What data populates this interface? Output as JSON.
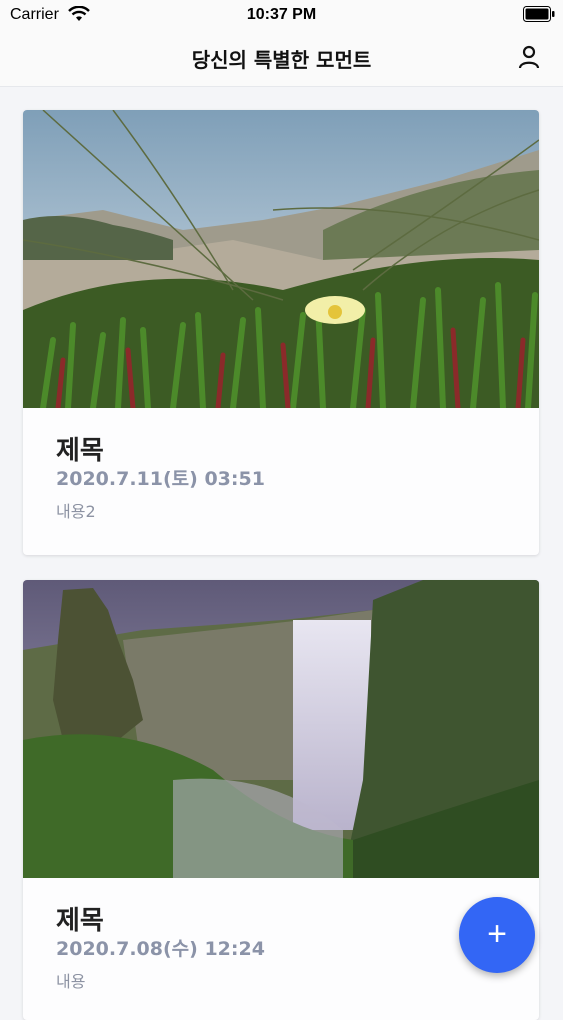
{
  "status_bar": {
    "carrier": "Carrier",
    "time": "10:37 PM",
    "icons": [
      "wifi-icon",
      "battery-icon"
    ]
  },
  "nav": {
    "title": "당신의 특별한 모먼트",
    "profile_icon": "person-icon"
  },
  "cards": [
    {
      "title": "제목",
      "date": "2020.7.11(토) 03:51",
      "content": "내용2",
      "image": "coastal dune grass with yellow flower photo"
    },
    {
      "title": "제목",
      "date": "2020.7.08(수) 12:24",
      "content": "내용",
      "image": "waterfall canyon photo"
    }
  ],
  "fab": {
    "label": "+"
  },
  "colors": {
    "accent": "#3366f5",
    "date_text": "#8b93a8",
    "background": "#f4f5f8"
  }
}
